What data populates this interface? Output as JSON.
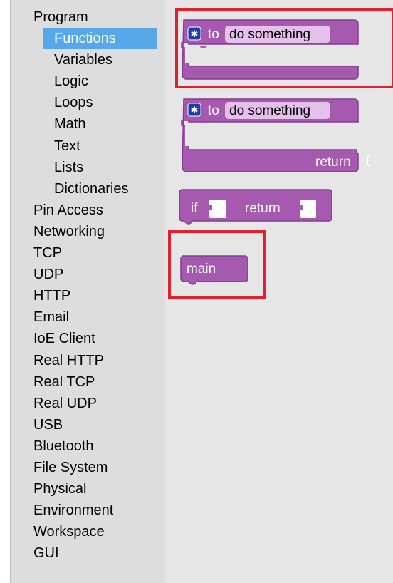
{
  "toolbox": {
    "items": [
      {
        "label": "Program",
        "level": 0,
        "selected": false
      },
      {
        "label": "Functions",
        "level": 1,
        "selected": true
      },
      {
        "label": "Variables",
        "level": 1,
        "selected": false
      },
      {
        "label": "Logic",
        "level": 1,
        "selected": false
      },
      {
        "label": "Loops",
        "level": 1,
        "selected": false
      },
      {
        "label": "Math",
        "level": 1,
        "selected": false
      },
      {
        "label": "Text",
        "level": 1,
        "selected": false
      },
      {
        "label": "Lists",
        "level": 1,
        "selected": false
      },
      {
        "label": "Dictionaries",
        "level": 1,
        "selected": false
      },
      {
        "label": "Pin Access",
        "level": 0,
        "selected": false
      },
      {
        "label": "Networking",
        "level": 0,
        "selected": false
      },
      {
        "label": "TCP",
        "level": 0,
        "selected": false
      },
      {
        "label": "UDP",
        "level": 0,
        "selected": false
      },
      {
        "label": "HTTP",
        "level": 0,
        "selected": false
      },
      {
        "label": "Email",
        "level": 0,
        "selected": false
      },
      {
        "label": "IoE Client",
        "level": 0,
        "selected": false
      },
      {
        "label": "Real HTTP",
        "level": 0,
        "selected": false
      },
      {
        "label": "Real TCP",
        "level": 0,
        "selected": false
      },
      {
        "label": "Real UDP",
        "level": 0,
        "selected": false
      },
      {
        "label": "USB",
        "level": 0,
        "selected": false
      },
      {
        "label": "Bluetooth",
        "level": 0,
        "selected": false
      },
      {
        "label": "File System",
        "level": 0,
        "selected": false
      },
      {
        "label": "Physical",
        "level": 0,
        "selected": false
      },
      {
        "label": "Environment",
        "level": 0,
        "selected": false
      },
      {
        "label": "Workspace",
        "level": 0,
        "selected": false
      },
      {
        "label": "GUI",
        "level": 0,
        "selected": false
      }
    ]
  },
  "blocks": {
    "procedure_no_return": {
      "keyword": "to",
      "name": "do something",
      "gear_icon": "star-gear-icon"
    },
    "procedure_with_return": {
      "keyword": "to",
      "name": "do something",
      "return_label": "return",
      "gear_icon": "star-gear-icon"
    },
    "if_return": {
      "if_label": "if",
      "return_label": "return"
    },
    "main_call": {
      "label": "main"
    }
  },
  "colors": {
    "block_fill": "#a55ab0",
    "block_stroke": "#7f3f8c",
    "field_bg": "#e4c0ea",
    "gear_bg": "#1e3ea6",
    "selection_bg": "#57a8e8",
    "highlight": "#e0202e"
  }
}
